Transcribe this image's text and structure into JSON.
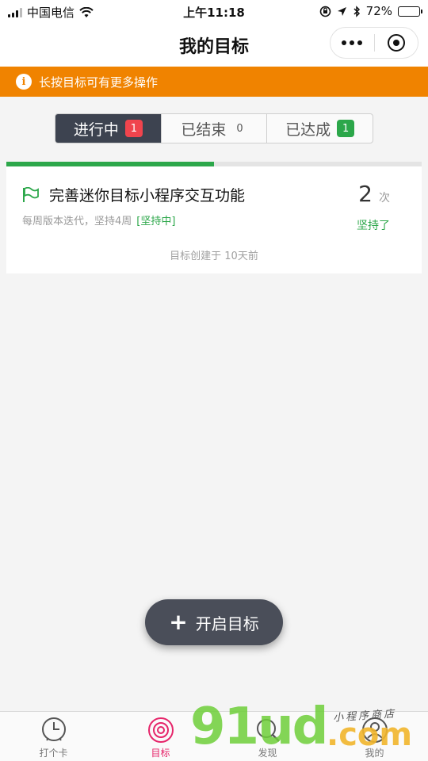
{
  "status_bar": {
    "carrier": "中国电信",
    "time": "上午11:18",
    "battery": "72%",
    "battery_level": 0.72
  },
  "nav": {
    "title": "我的目标"
  },
  "tip": {
    "icon": "info-icon",
    "icon_glyph": "i",
    "text": "长按目标可有更多操作"
  },
  "tabs": [
    {
      "label": "进行中",
      "count": "1",
      "active": true
    },
    {
      "label": "已结束",
      "count": "0",
      "active": false
    },
    {
      "label": "已达成",
      "count": "1",
      "active": false
    }
  ],
  "goal": {
    "title": "完善迷你目标小程序交互功能",
    "subtitle": "每周版本迭代，坚持4周",
    "status": "[坚持中]",
    "count": "2",
    "count_unit": "次",
    "persisted_label": "坚持了",
    "created": "目标创建于  10天前",
    "progress": 0.5
  },
  "fab": {
    "icon_glyph": "+",
    "label": "开启目标"
  },
  "tabbar": [
    {
      "label": "打个卡",
      "icon": "clock-icon",
      "active": false
    },
    {
      "label": "目标",
      "icon": "target-icon",
      "active": true
    },
    {
      "label": "发现",
      "icon": "search-icon",
      "active": false
    },
    {
      "label": "我的",
      "icon": "user-icon",
      "active": false
    }
  ],
  "watermark": {
    "brand": "91ud",
    "domain": ".com",
    "tagline": "小程序商店"
  },
  "colors": {
    "accent_orange": "#f08300",
    "success_green": "#2ca74a",
    "badge_red": "#f0444d",
    "tab_active_bg": "#3d4350",
    "tabbar_active": "#e6256a"
  }
}
